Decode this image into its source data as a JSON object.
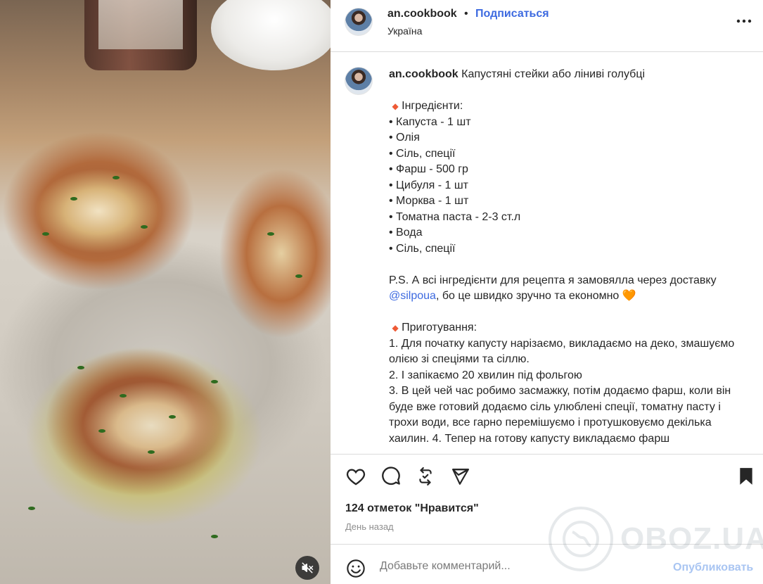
{
  "header": {
    "username": "an.cookbook",
    "separator": "•",
    "follow_label": "Подписаться",
    "location": "Україна"
  },
  "caption": {
    "username": "an.cookbook",
    "title": "Капустяні стейки або ліниві голубці",
    "ingredients_heading": "Інгредієнти:",
    "ingredients": [
      "• Капуста - 1 шт",
      "• Олія",
      "• Сіль, спеції",
      "• Фарш - 500 гр",
      "• Цибуля - 1 шт",
      "• Морква - 1 шт",
      "• Томатна паста - 2-3 ст.л",
      "• Вода",
      "• Сіль, спеції"
    ],
    "ps_text": "P.S. А всі інгредієнти для рецепта я замовялла через доставку",
    "mention": "@silpoua",
    "ps_tail": ", бо це швидко зручно та економно",
    "heart": "🧡",
    "diamond": "◆",
    "cooking_heading": "Приготування:",
    "steps": [
      "1. Для початку капусту нарізаємо, викладаємо на деко, змашуємо олією зі спеціями та сіллю.",
      "2. І запікаємо 20 хвилин під фольгою",
      "3. В цей чей час робимо засмажку, потім додаємо фарш, коли він буде вже готовий додаємо сіль улюблені спеції, томатну пасту і трохи води, все гарно перемішуємо і протушковуємо декілька хаилин. 4. Тепер на готову капусту викладаємо фарш"
    ]
  },
  "actions": {
    "likes": "124 отметок \"Нравится\"",
    "time": "День назад"
  },
  "comment": {
    "placeholder": "Добавьте комментарий...",
    "publish_label": "Опубликовать"
  },
  "watermark": "OBOZ.UA",
  "colors": {
    "link_blue": "#3d6ae0",
    "publish_disabled": "#a9c5f2",
    "accent_diamond": "#ee5a36"
  }
}
